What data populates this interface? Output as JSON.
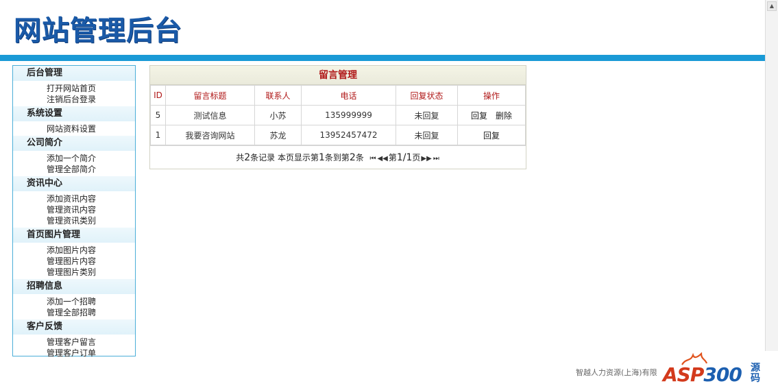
{
  "header": {
    "title": "网站管理后台"
  },
  "sidebar": {
    "groups": [
      {
        "title": "后台管理",
        "items": [
          "打开网站首页",
          "注销后台登录"
        ]
      },
      {
        "title": "系统设置",
        "items": [
          "网站资料设置"
        ]
      },
      {
        "title": "公司简介",
        "items": [
          "添加一个简介",
          "管理全部简介"
        ]
      },
      {
        "title": "资讯中心",
        "items": [
          "添加资讯内容",
          "管理资讯内容",
          "管理资讯类别"
        ]
      },
      {
        "title": "首页图片管理",
        "items": [
          "添加图片内容",
          "管理图片内容",
          "管理图片类别"
        ]
      },
      {
        "title": "招聘信息",
        "items": [
          "添加一个招聘",
          "管理全部招聘"
        ]
      },
      {
        "title": "客户反馈",
        "items": [
          "管理客户留言",
          "管理客户订单"
        ]
      }
    ]
  },
  "panel": {
    "title": "留言管理",
    "columns": [
      "ID",
      "留言标题",
      "联系人",
      "电话",
      "回复状态",
      "操作"
    ],
    "rows": [
      {
        "id": "5",
        "title": "测试信息",
        "contact": "小苏",
        "phone": "135999999",
        "status": "未回复",
        "reply": "回复",
        "delete": "删除"
      },
      {
        "id": "1",
        "title": "我要咨询网站",
        "contact": "苏龙",
        "phone": "13952457472",
        "status": "未回复",
        "reply": "回复"
      }
    ],
    "pager": {
      "prefix": "共",
      "total": "2",
      "records": "条记录 本页显示第",
      "from": "1",
      "mid": "条到第",
      "to": "2",
      "suffix": "条",
      "first": "⏮",
      "prev": "◀◀",
      "page_prefix": "第",
      "page": "1/1",
      "page_suffix": "页",
      "next": "▶▶",
      "last": "⏭"
    }
  },
  "footer": {
    "text": "智越人力资源(上海)有限"
  },
  "watermark": {
    "brand_a": "ASP",
    "brand_b": "300",
    "cn_top": "源",
    "cn_bottom": "码"
  },
  "colors": {
    "accent": "#1a9ad6",
    "title_blue": "#1a5aa8",
    "red": "#b01818"
  }
}
